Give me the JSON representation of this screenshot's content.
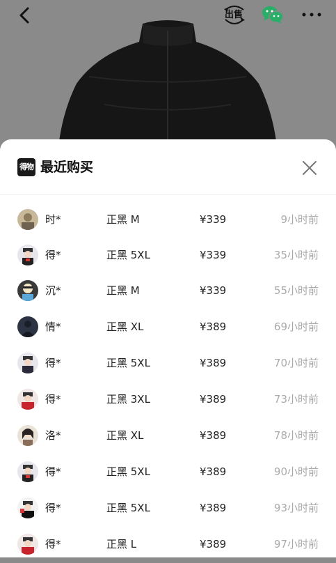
{
  "header": {
    "sell_label": "出售"
  },
  "modal": {
    "brand_logo_text": "得物",
    "title": "最近购买"
  },
  "colors": {
    "overlay": "#8a8a8a",
    "sheet": "#ffffff",
    "text_primary": "#222222",
    "text_secondary": "#aaaaaa",
    "wechat_green": "#2aae67"
  },
  "purchases": [
    {
      "name": "时*",
      "spec": "正黑 M",
      "price": "¥339",
      "time": "9小时前",
      "avatar_icon": "photo-avatar-icon"
    },
    {
      "name": "得*",
      "spec": "正黑 5XL",
      "price": "¥339",
      "time": "35小时前",
      "avatar_icon": "default-user-avatar-icon"
    },
    {
      "name": "沉*",
      "spec": "正黑 M",
      "price": "¥339",
      "time": "55小时前",
      "avatar_icon": "photo-avatar-icon"
    },
    {
      "name": "情*",
      "spec": "正黑 XL",
      "price": "¥389",
      "time": "69小时前",
      "avatar_icon": "photo-avatar-icon"
    },
    {
      "name": "得*",
      "spec": "正黑 5XL",
      "price": "¥389",
      "time": "70小时前",
      "avatar_icon": "default-user-avatar-icon"
    },
    {
      "name": "得*",
      "spec": "正黑 3XL",
      "price": "¥389",
      "time": "73小时前",
      "avatar_icon": "default-user-avatar-icon"
    },
    {
      "name": "洛*",
      "spec": "正黑 XL",
      "price": "¥389",
      "time": "78小时前",
      "avatar_icon": "photo-avatar-icon"
    },
    {
      "name": "得*",
      "spec": "正黑 5XL",
      "price": "¥389",
      "time": "90小时前",
      "avatar_icon": "default-user-avatar-icon"
    },
    {
      "name": "得*",
      "spec": "正黑 5XL",
      "price": "¥389",
      "time": "93小时前",
      "avatar_icon": "default-user-avatar-icon"
    },
    {
      "name": "得*",
      "spec": "正黑 L",
      "price": "¥389",
      "time": "97小时前",
      "avatar_icon": "default-user-avatar-icon"
    }
  ]
}
